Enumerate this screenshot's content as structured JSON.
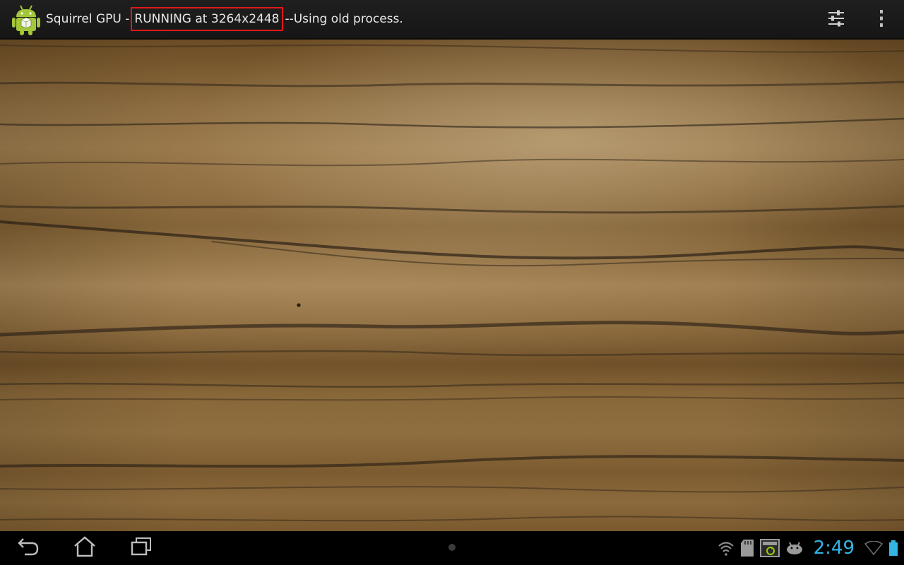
{
  "action_bar": {
    "title_prefix": "Squirrel GPU - ",
    "status": "RUNNING at 3264x2448",
    "title_suffix": "--Using old process.",
    "icons": [
      "android-app-icon",
      "settings-sliders-icon",
      "overflow-menu-icon"
    ]
  },
  "system_bar": {
    "nav_icons": [
      "back-icon",
      "home-icon",
      "recent-apps-icon"
    ],
    "status_icons": [
      "wifi-question-icon",
      "sd-card-icon",
      "screenshot-icon",
      "android-debug-icon"
    ],
    "clock": "2:49",
    "indicators": [
      "wifi-icon",
      "battery-icon"
    ]
  },
  "colors": {
    "action_bar_bg": "#1c1c1c",
    "status_highlight": "#e01818",
    "clock": "#33b5e5"
  }
}
